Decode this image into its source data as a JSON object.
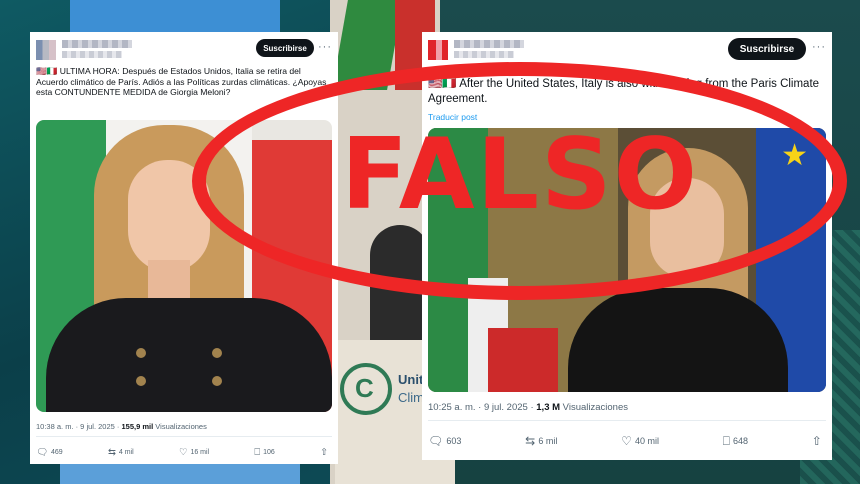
{
  "left_post": {
    "subscribe_label": "Suscribirse",
    "more_label": "···",
    "flags": "🇺🇸🇮🇹",
    "text": "ULTIMA HORA: Después de Estados Unidos, Italia se retira del Acuerdo climático de París. Adiós a las Políticas zurdas climáticas. ¿Apoyas esta CONTUNDENTE MEDIDA de Giorgia Meloni?",
    "timestamp": "10:38 a. m. · 9 jul. 2025",
    "views_count": "155,9 mil",
    "views_label": "Visualizaciones",
    "replies": "469",
    "reposts": "4 mil",
    "likes": "16 mil",
    "bookmarks": "106"
  },
  "right_post": {
    "subscribe_label": "Suscribirse",
    "more_label": "···",
    "flags": "🇺🇸🇮🇹",
    "text": "After the United States, Italy is also withdrawing from the Paris Climate Agreement.",
    "translate_label": "Traducir post",
    "timestamp": "10:25 a. m. · 9 jul. 2025",
    "views_count": "1,3 M",
    "views_label": "Visualizaciones",
    "replies": "603",
    "reposts": "6 mil",
    "likes": "40 mil",
    "bookmarks": "648"
  },
  "background": {
    "cop_text_line1": "Unit",
    "cop_text_line2": "Clim"
  },
  "stamp": {
    "label": "FALSO",
    "color": "#ee2626"
  },
  "icons": {
    "reply": "reply-icon",
    "repost": "repost-icon",
    "like": "heart-icon",
    "bookmark": "bookmark-icon",
    "share": "share-icon"
  }
}
